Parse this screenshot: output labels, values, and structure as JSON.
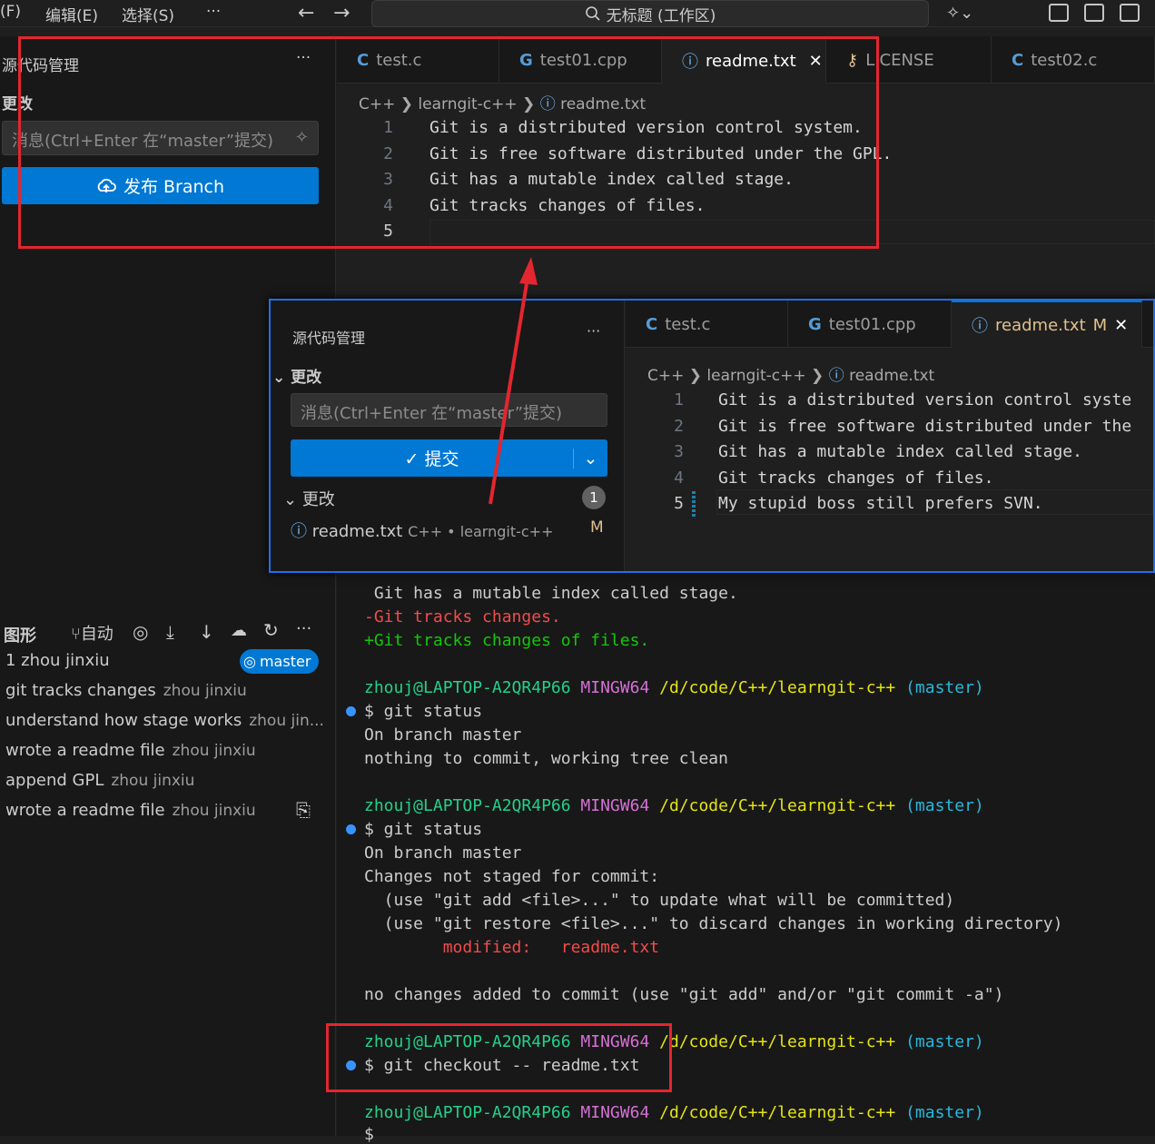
{
  "menubar": {
    "file": "(F)",
    "edit": "编辑(E)",
    "select": "选择(S)",
    "more": "···",
    "search": "无标题 (工作区)"
  },
  "sidebar": {
    "title": "源代码管理",
    "more": "···",
    "section": "更改",
    "message_placeholder": "消息(Ctrl+Enter 在“master”提交)",
    "publish_label": "发布 Branch",
    "graph": {
      "title": "图形",
      "auto": "自动",
      "more": "···",
      "items": [
        {
          "msg": "1  zhou jinxiu",
          "author": "",
          "badge": "master"
        },
        {
          "msg": "git tracks changes",
          "author": "zhou jinxiu"
        },
        {
          "msg": "understand how stage works",
          "author": "zhou jin..."
        },
        {
          "msg": "wrote a readme file",
          "author": "zhou jinxiu"
        },
        {
          "msg": "append GPL",
          "author": "zhou jinxiu"
        },
        {
          "msg": "wrote a readme file",
          "author": "zhou jinxiu"
        }
      ]
    }
  },
  "editor": {
    "tabs": [
      "test.c",
      "test01.cpp",
      "readme.txt",
      "LICENSE",
      "test02.c"
    ],
    "breadcrumb": [
      "C++",
      "learngit-c++",
      "readme.txt"
    ],
    "lines": [
      "Git is a distributed version control system.",
      "Git is free software distributed under the GPL.",
      "Git has a mutable index called stage.",
      "Git tracks changes of files.",
      ""
    ]
  },
  "overlay": {
    "title": "源代码管理",
    "more": "···",
    "section": "更改",
    "message_placeholder": "消息(Ctrl+Enter 在“master”提交)",
    "commit_label": "提交",
    "changes_label": "更改",
    "changes_count": "1",
    "file": {
      "name": "readme.txt",
      "path": "C++ • learngit-c++",
      "status": "M"
    },
    "tabs": [
      "test.c",
      "test01.cpp",
      "readme.txt"
    ],
    "active_tab_status": "M",
    "breadcrumb": [
      "C++",
      "learngit-c++",
      "readme.txt"
    ],
    "lines": [
      "Git is a distributed version control syste",
      "Git is free software distributed under the",
      "Git has a mutable index called stage.",
      "Git tracks changes of files.",
      "My stupid boss still prefers SVN."
    ]
  },
  "terminal": {
    "diff": [
      " Git has a mutable index called stage.",
      "-Git tracks changes.",
      "+Git tracks changes of files."
    ],
    "prompt_user": "zhouj@LAPTOP-A2QR4P66",
    "prompt_env": "MINGW64",
    "prompt_path": "/d/code/C++/learngit-c++",
    "prompt_branch": "(master)",
    "cmd1": "$ git status",
    "out1a": "On branch master",
    "out1b": "nothing to commit, working tree clean",
    "cmd2": "$ git status",
    "out2a": "On branch master",
    "out2b": "Changes not staged for commit:",
    "out2c": "  (use \"git add <file>...\" to update what will be committed)",
    "out2d": "  (use \"git restore <file>...\" to discard changes in working directory)",
    "out2e": "        modified:   readme.txt",
    "out2f": "no changes added to commit (use \"git add\" and/or \"git commit -a\")",
    "cmd3": "$ git checkout -- readme.txt",
    "cmd4": "$ "
  },
  "colors": {
    "accent": "#0078d4",
    "annotation": "#e3262f"
  }
}
